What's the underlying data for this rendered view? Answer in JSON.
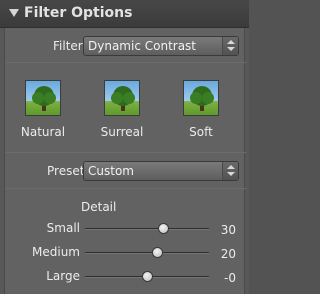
{
  "header": {
    "title": "Filter Options"
  },
  "filter_row": {
    "label": "Filter",
    "value": "Dynamic Contrast"
  },
  "filters": [
    {
      "label": "Natural"
    },
    {
      "label": "Surreal"
    },
    {
      "label": "Soft"
    }
  ],
  "preset_row": {
    "label": "Preset",
    "value": "Custom"
  },
  "detail": {
    "title": "Detail",
    "sliders": [
      {
        "label": "Small",
        "value": "30",
        "level": 0.63
      },
      {
        "label": "Medium",
        "value": "20",
        "level": 0.58
      },
      {
        "label": "Large",
        "value": "-0",
        "level": 0.5
      }
    ]
  }
}
